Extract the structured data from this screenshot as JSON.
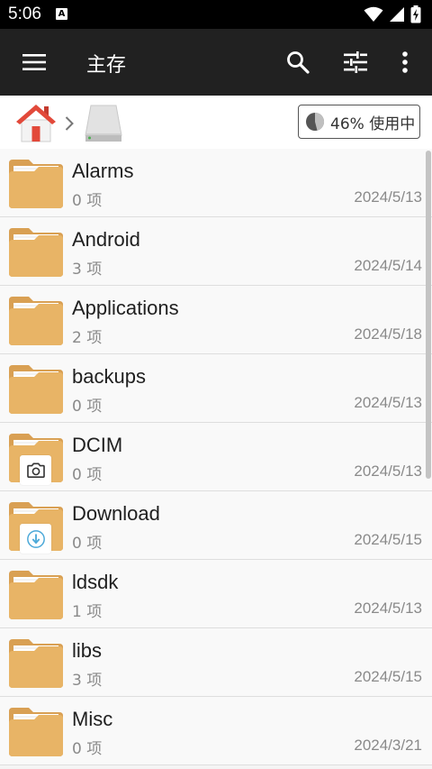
{
  "status_bar": {
    "time": "5:06",
    "notification_icon": "a-box-icon",
    "wifi_icon": "wifi-icon",
    "signal_icon": "signal-icon",
    "battery_icon": "battery-charging-icon"
  },
  "app_bar": {
    "title": "主存",
    "menu_icon": "hamburger-menu-icon",
    "search_icon": "search-icon",
    "filter_icon": "sliders-icon",
    "more_icon": "more-vert-icon",
    "background": "#212121"
  },
  "path_bar": {
    "home_icon": "home-icon",
    "separator_icon": "chevron-right-icon",
    "storage_icon": "drive-icon",
    "usage_text": "46% 使用中",
    "usage_percent": 46
  },
  "colors": {
    "folder": "#E8B466",
    "folder_back": "#D9A053",
    "paper": "#FFFFFF",
    "download_accent": "#4AA8D8"
  },
  "files": [
    {
      "name": "Alarms",
      "count": "0 项",
      "date": "2024/5/13",
      "badge": ""
    },
    {
      "name": "Android",
      "count": "3 项",
      "date": "2024/5/14",
      "badge": ""
    },
    {
      "name": "Applications",
      "count": "2 项",
      "date": "2024/5/18",
      "badge": ""
    },
    {
      "name": "backups",
      "count": "0 项",
      "date": "2024/5/13",
      "badge": ""
    },
    {
      "name": "DCIM",
      "count": "0 项",
      "date": "2024/5/13",
      "badge": "camera-icon"
    },
    {
      "name": "Download",
      "count": "0 项",
      "date": "2024/5/15",
      "badge": "download-icon"
    },
    {
      "name": "ldsdk",
      "count": "1 项",
      "date": "2024/5/13",
      "badge": ""
    },
    {
      "name": "libs",
      "count": "3 项",
      "date": "2024/5/15",
      "badge": ""
    },
    {
      "name": "Misc",
      "count": "0 项",
      "date": "2024/3/21",
      "badge": ""
    }
  ]
}
